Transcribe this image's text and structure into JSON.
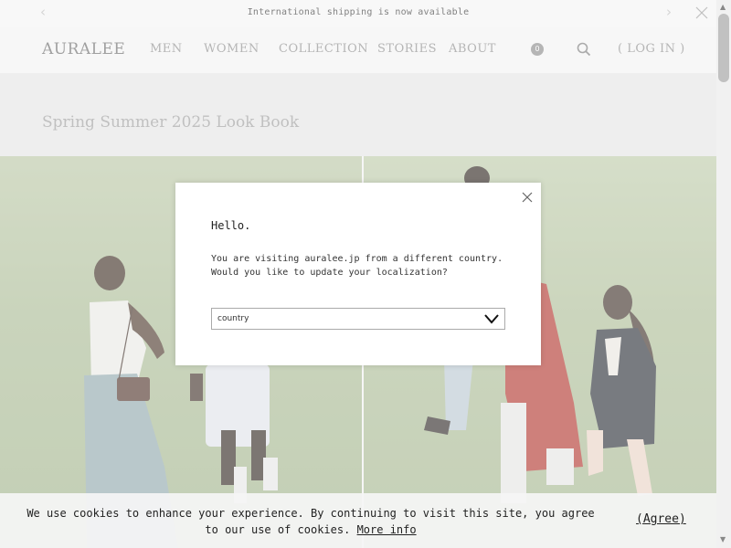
{
  "announcement": {
    "text": "International shipping is now available",
    "prev_icon": "chevron-left-icon",
    "next_icon": "chevron-right-icon",
    "close_icon": "close-icon"
  },
  "header": {
    "logo": "AURALEE",
    "nav": [
      "MEN",
      "WOMEN",
      "COLLECTION",
      "STORIES",
      "ABOUT"
    ],
    "cart_count": "0",
    "search_icon": "search-icon",
    "login": "( LOG IN )"
  },
  "page": {
    "title": "Spring Summer 2025 Look Book"
  },
  "modal": {
    "greeting": "Hello.",
    "message_line1": "You are visiting auralee.jp from a different country.",
    "message_line2": "Would you like to update your localization?",
    "select_value": "country",
    "close_icon": "close-icon",
    "select_icon": "chevron-down-icon"
  },
  "cookie": {
    "text": "We use cookies to enhance your experience. By continuing to visit this site, you agree to our use of cookies.",
    "more_link": "More info",
    "agree": "(Agree)"
  },
  "colors": {
    "grass": "#a9ba93",
    "overlay": "rgba(255,255,255,0.38)",
    "text_dark": "#222222"
  }
}
